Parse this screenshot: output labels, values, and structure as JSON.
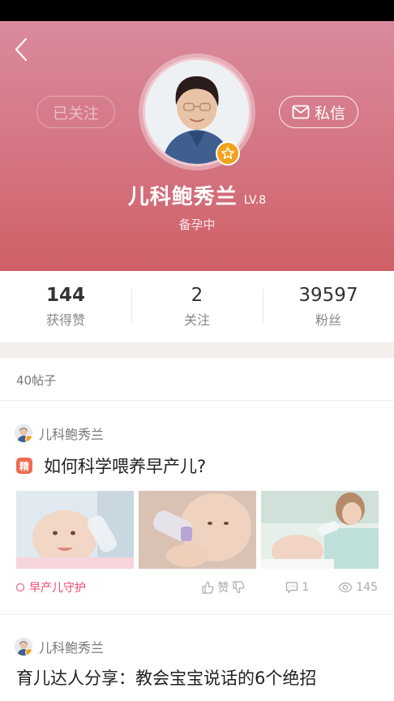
{
  "header": {
    "follow_label": "已关注",
    "message_label": "私信",
    "user_name": "儿科鲍秀兰",
    "level": "LV.8",
    "status": "备孕中"
  },
  "stats": [
    {
      "value": "144",
      "label": "获得赞"
    },
    {
      "value": "2",
      "label": "关注"
    },
    {
      "value": "39597",
      "label": "粉丝"
    }
  ],
  "posts_section": {
    "count_label": "40帖子"
  },
  "posts": [
    {
      "author": "儿科鲍秀兰",
      "badge": "精",
      "title": "如何科学喂养早产儿?",
      "tag": "早产儿守护",
      "like_label": "赞",
      "comments": "1",
      "views": "145"
    },
    {
      "author": "儿科鲍秀兰",
      "title": "育儿达人分享：教会宝宝说话的6个绝招"
    }
  ],
  "colors": {
    "header_top": "#d98a9c",
    "header_bottom": "#cf5f66",
    "accent_pink": "#e9466c",
    "badge_orange": "#f4a21d",
    "jing_red": "#f16a52"
  },
  "icons": {
    "back": "chevron-left-icon",
    "message": "mail-icon",
    "verified": "star-badge-icon",
    "like": "thumbs-up-icon",
    "dislike": "thumbs-down-icon",
    "comment": "comment-icon",
    "views": "eye-icon"
  }
}
